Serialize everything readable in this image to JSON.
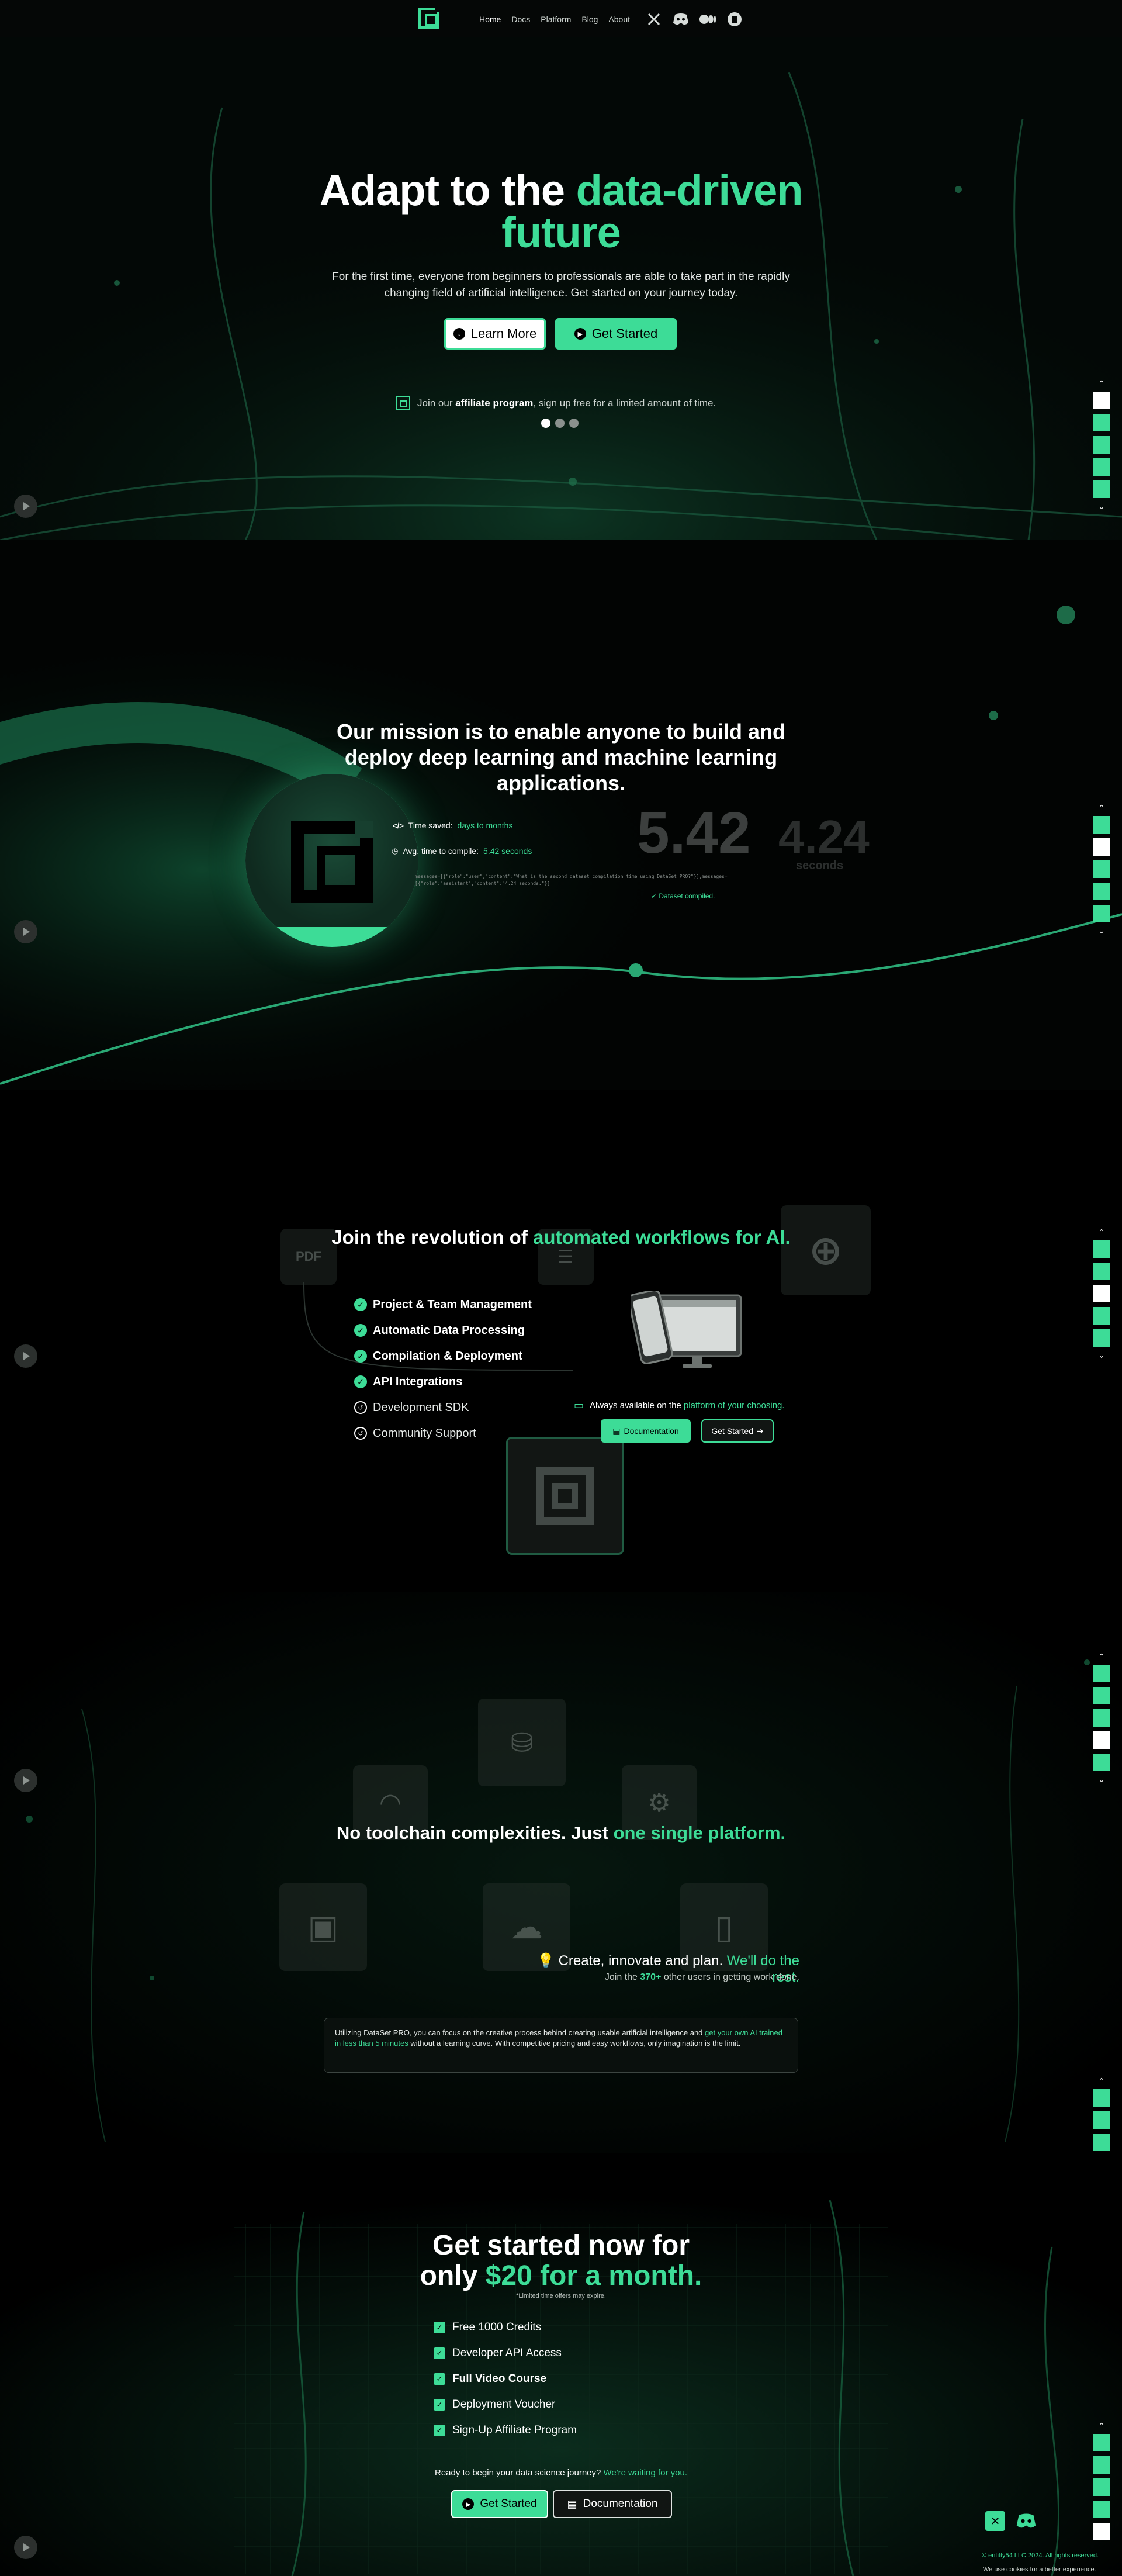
{
  "colors": {
    "accent": "#3ddc97",
    "background": "#000000",
    "text": "#ffffff"
  },
  "nav": {
    "items": [
      "Home",
      "Docs",
      "Platform",
      "Blog",
      "About"
    ],
    "social": [
      "x-icon",
      "discord-icon",
      "medium-icon",
      "github-icon"
    ]
  },
  "hero": {
    "title_white": "Adapt to the ",
    "title_green": "data-driven future",
    "subtitle": "For the first time, everyone from beginners to professionals are able to take part in the rapidly changing field of artificial intelligence. Get started on your journey today.",
    "learn_more": "Learn More",
    "get_started": "Get Started",
    "affiliate_pre": "Join our ",
    "affiliate_bold": "affiliate program",
    "affiliate_post": ", sign up free for a limited amount of time."
  },
  "mission": {
    "title": "Our mission is to enable anyone to build and deploy deep learning and machine learning applications.",
    "time_saved_label": "Time saved:",
    "time_saved_value": "days to months",
    "compile_label": "Avg. time to compile:",
    "compile_value": "5.42 seconds",
    "big_number": "5.42",
    "big_number_secondary": "4.24",
    "seconds_label": "seconds",
    "code": "messages=[{\"role\":\"user\",\"content\":\"What is the second dataset compilation time using DataSet PRO?\"}],messages=[{\"role\":\"assistant\",\"content\":\"4.24 seconds.\"}]",
    "compiled": "Dataset compiled."
  },
  "workflows": {
    "title_white": "Join the revolution of ",
    "title_green": "automated workflows for AI.",
    "features": [
      {
        "label": "Project & Team Management",
        "status": "available"
      },
      {
        "label": "Automatic Data Processing",
        "status": "available"
      },
      {
        "label": "Compilation & Deployment",
        "status": "available"
      },
      {
        "label": "API Integrations",
        "status": "available"
      },
      {
        "label": "Development SDK",
        "status": "coming-soon"
      },
      {
        "label": "Community Support",
        "status": "coming-soon"
      }
    ],
    "available_pre": "Always available on the ",
    "available_green": "platform of your choosing.",
    "documentation": "Documentation",
    "get_started": "Get Started"
  },
  "toolchain": {
    "title_white": "No toolchain complexities. Just ",
    "title_green": "one single platform.",
    "create_white": "Create, innovate and plan. ",
    "create_green": "We'll do the rest.",
    "join_pre": "Join the ",
    "join_green": "370+",
    "join_post": " other users in getting work done.",
    "info_pre": "Utilizing DataSet PRO, you can focus on the creative process behind creating usable artificial intelligence and ",
    "info_green": "get your own AI trained in less than 5 minutes",
    "info_post": " without a learning curve. With competitive pricing and easy workflows, only imagination is the limit."
  },
  "pricing": {
    "title_line1": "Get started now for",
    "title_pre": "only ",
    "title_green": "$20 for a month.",
    "limited": "*Limited time offers may expire.",
    "features": [
      "Free 1000 Credits",
      "Developer API Access",
      "Full Video Course",
      "Deployment Voucher",
      "Sign-Up Affiliate Program"
    ],
    "ready_white": "Ready to begin your data science journey? ",
    "ready_green": "We're waiting for you.",
    "get_started": "Get Started",
    "documentation": "Documentation"
  },
  "footer": {
    "copyright": "© entitty54 LLC 2024. All rights reserved.",
    "cookies": "We use cookies for a better experience."
  }
}
